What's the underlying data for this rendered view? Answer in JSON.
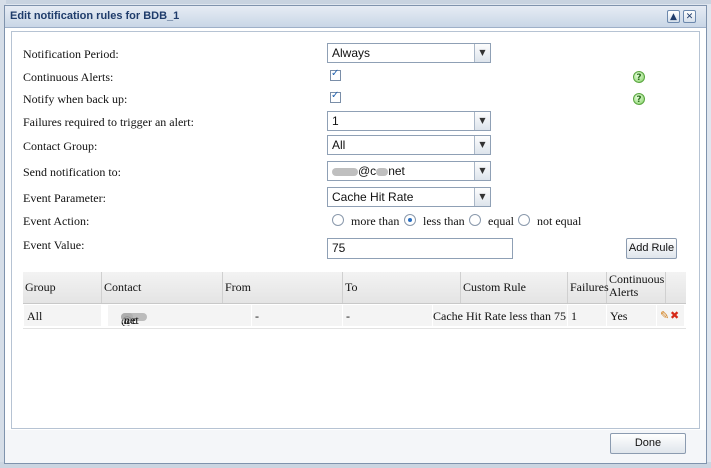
{
  "dialog": {
    "title": "Edit notification rules for BDB_1",
    "collapse_glyph": "▲",
    "close_glyph": "✕"
  },
  "form": {
    "notification_period": {
      "label": "Notification Period:",
      "value": "Always"
    },
    "continuous_alerts": {
      "label": "Continuous Alerts:",
      "checked": true
    },
    "notify_back_up": {
      "label": "Notify when back up:",
      "checked": true
    },
    "failures_required": {
      "label": "Failures required to trigger an alert:",
      "value": "1"
    },
    "contact_group": {
      "label": "Contact Group:",
      "value": "All"
    },
    "send_to": {
      "label": "Send notification to:",
      "value_mid": "@c",
      "value_end": "net"
    },
    "event_parameter": {
      "label": "Event Parameter:",
      "value": "Cache Hit Rate"
    },
    "event_action": {
      "label": "Event Action:",
      "options": [
        "more than",
        "less than",
        "equal",
        "not equal"
      ],
      "selected": "less than"
    },
    "event_value": {
      "label": "Event Value:",
      "value": "75"
    },
    "add_rule_label": "Add Rule",
    "help_glyph": "?"
  },
  "grid": {
    "columns": [
      "Group",
      "Contact",
      "From",
      "To",
      "Custom Rule",
      "Failures",
      "Continuous",
      "Alerts"
    ],
    "rows": [
      {
        "group": "All",
        "contact_mid": "@c",
        "contact_end": ".net",
        "from": "-",
        "to": "-",
        "custom_rule": "Cache Hit Rate less than 75",
        "failures": "1",
        "continuous_alerts": "Yes"
      }
    ]
  },
  "footer": {
    "done_label": "Done"
  },
  "icons": {
    "dropdown": "chevron-down-icon",
    "edit": "pencil-icon",
    "delete": "delete-icon",
    "help": "help-icon",
    "check": "check-icon"
  },
  "colors": {
    "title_text": "#1f3c6b",
    "help_green": "#7fcf5f",
    "radio_selected": "#2a6fc2",
    "edit_orange": "#d07a12",
    "delete_red": "#d62a1a"
  }
}
